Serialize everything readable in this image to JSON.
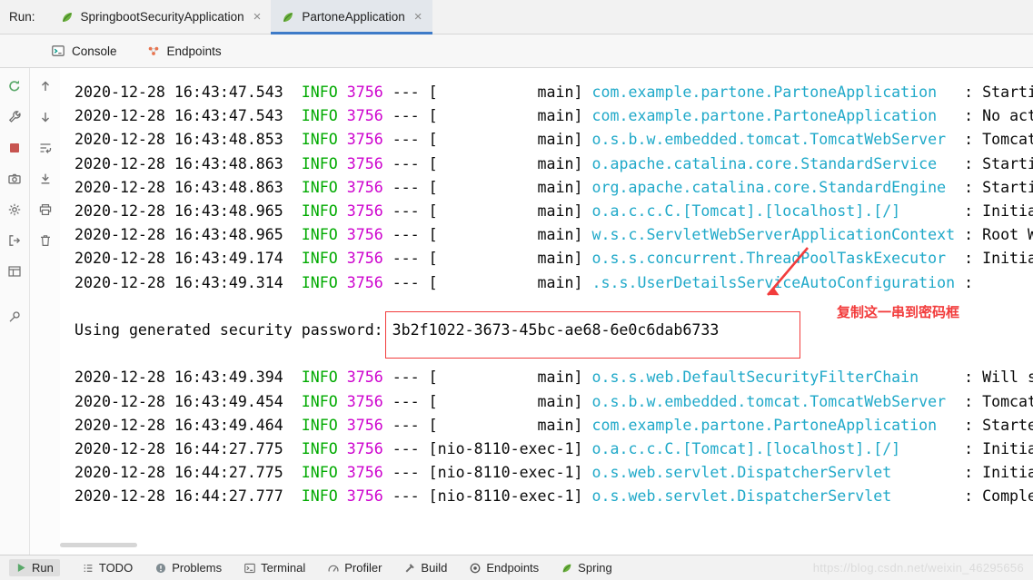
{
  "run_bar": {
    "label": "Run:",
    "tabs": [
      {
        "label": "SpringbootSecurityApplication",
        "close_glyph": "×",
        "selected": false
      },
      {
        "label": "PartoneApplication",
        "close_glyph": "×",
        "selected": true
      }
    ]
  },
  "view_tabs": [
    {
      "label": "Console",
      "selected": true
    },
    {
      "label": "Endpoints",
      "selected": false
    }
  ],
  "toolbars": {
    "run_actions": [
      "rerun-icon",
      "wrench-icon",
      "stop-icon",
      "camera-icon",
      "gear-icon",
      "exit-icon",
      "restore-layout-icon",
      "pin-icon"
    ],
    "console_actions": [
      "arrow-up-icon",
      "arrow-down-icon",
      "soft-wrap-icon",
      "scroll-to-end-icon",
      "printer-icon",
      "trash-icon"
    ]
  },
  "log": {
    "password_prefix": "Using generated security password: ",
    "password": "3b2f1022-3673-45bc-ae68-6e0c6dab6733",
    "annotation": "复制这一串到密码框",
    "lines": [
      {
        "type": "log",
        "time": "2020-12-28 16:43:47.543",
        "level": "INFO",
        "pid": "3756",
        "thread": "main",
        "logger": "com.example.partone.PartoneApplication",
        "msg": "Starti"
      },
      {
        "type": "log",
        "time": "2020-12-28 16:43:47.543",
        "level": "INFO",
        "pid": "3756",
        "thread": "main",
        "logger": "com.example.partone.PartoneApplication",
        "msg": "No act"
      },
      {
        "type": "log",
        "time": "2020-12-28 16:43:48.853",
        "level": "INFO",
        "pid": "3756",
        "thread": "main",
        "logger": "o.s.b.w.embedded.tomcat.TomcatWebServer",
        "msg": "Tomcat"
      },
      {
        "type": "log",
        "time": "2020-12-28 16:43:48.863",
        "level": "INFO",
        "pid": "3756",
        "thread": "main",
        "logger": "o.apache.catalina.core.StandardService",
        "msg": "Starti"
      },
      {
        "type": "log",
        "time": "2020-12-28 16:43:48.863",
        "level": "INFO",
        "pid": "3756",
        "thread": "main",
        "logger": "org.apache.catalina.core.StandardEngine",
        "msg": "Starti"
      },
      {
        "type": "log",
        "time": "2020-12-28 16:43:48.965",
        "level": "INFO",
        "pid": "3756",
        "thread": "main",
        "logger": "o.a.c.c.C.[Tomcat].[localhost].[/]",
        "msg": "Initia"
      },
      {
        "type": "log",
        "time": "2020-12-28 16:43:48.965",
        "level": "INFO",
        "pid": "3756",
        "thread": "main",
        "logger": "w.s.c.ServletWebServerApplicationContext",
        "msg": "Root W"
      },
      {
        "type": "log",
        "time": "2020-12-28 16:43:49.174",
        "level": "INFO",
        "pid": "3756",
        "thread": "main",
        "logger": "o.s.s.concurrent.ThreadPoolTaskExecutor",
        "msg": "Initia"
      },
      {
        "type": "log",
        "time": "2020-12-28 16:43:49.314",
        "level": "INFO",
        "pid": "3756",
        "thread": "main",
        "logger": ".s.s.UserDetailsServiceAutoConfiguration",
        "msg": ""
      },
      {
        "type": "blank"
      },
      {
        "type": "password"
      },
      {
        "type": "blank"
      },
      {
        "type": "log",
        "time": "2020-12-28 16:43:49.394",
        "level": "INFO",
        "pid": "3756",
        "thread": "main",
        "logger": "o.s.s.web.DefaultSecurityFilterChain",
        "msg": "Will s"
      },
      {
        "type": "log",
        "time": "2020-12-28 16:43:49.454",
        "level": "INFO",
        "pid": "3756",
        "thread": "main",
        "logger": "o.s.b.w.embedded.tomcat.TomcatWebServer",
        "msg": "Tomcat"
      },
      {
        "type": "log",
        "time": "2020-12-28 16:43:49.464",
        "level": "INFO",
        "pid": "3756",
        "thread": "main",
        "logger": "com.example.partone.PartoneApplication",
        "msg": "Starte"
      },
      {
        "type": "log",
        "time": "2020-12-28 16:44:27.775",
        "level": "INFO",
        "pid": "3756",
        "thread": "nio-8110-exec-1",
        "logger": "o.a.c.c.C.[Tomcat].[localhost].[/]",
        "msg": "Initia"
      },
      {
        "type": "log",
        "time": "2020-12-28 16:44:27.775",
        "level": "INFO",
        "pid": "3756",
        "thread": "nio-8110-exec-1",
        "logger": "o.s.web.servlet.DispatcherServlet",
        "msg": "Initia"
      },
      {
        "type": "log",
        "time": "2020-12-28 16:44:27.777",
        "level": "INFO",
        "pid": "3756",
        "thread": "nio-8110-exec-1",
        "logger": "o.s.web.servlet.DispatcherServlet",
        "msg": "Comple"
      }
    ]
  },
  "status_bar": {
    "items": [
      {
        "label": "Run",
        "icon": "run-icon"
      },
      {
        "label": "TODO",
        "icon": "todo-icon"
      },
      {
        "label": "Problems",
        "icon": "problems-icon"
      },
      {
        "label": "Terminal",
        "icon": "terminal-icon"
      },
      {
        "label": "Profiler",
        "icon": "profiler-icon"
      },
      {
        "label": "Build",
        "icon": "build-icon"
      },
      {
        "label": "Endpoints",
        "icon": "endpoints-icon"
      },
      {
        "label": "Spring",
        "icon": "spring-icon"
      }
    ],
    "watermark": "https://blog.csdn.net/weixin_46295656"
  },
  "colors": {
    "info": "#00AA00",
    "pid": "#CD00CD",
    "logger": "#20A9C9",
    "annotation_red": "#F23C3C",
    "tab_underline": "#3E7BC8",
    "spring_green": "#6DB33F"
  }
}
